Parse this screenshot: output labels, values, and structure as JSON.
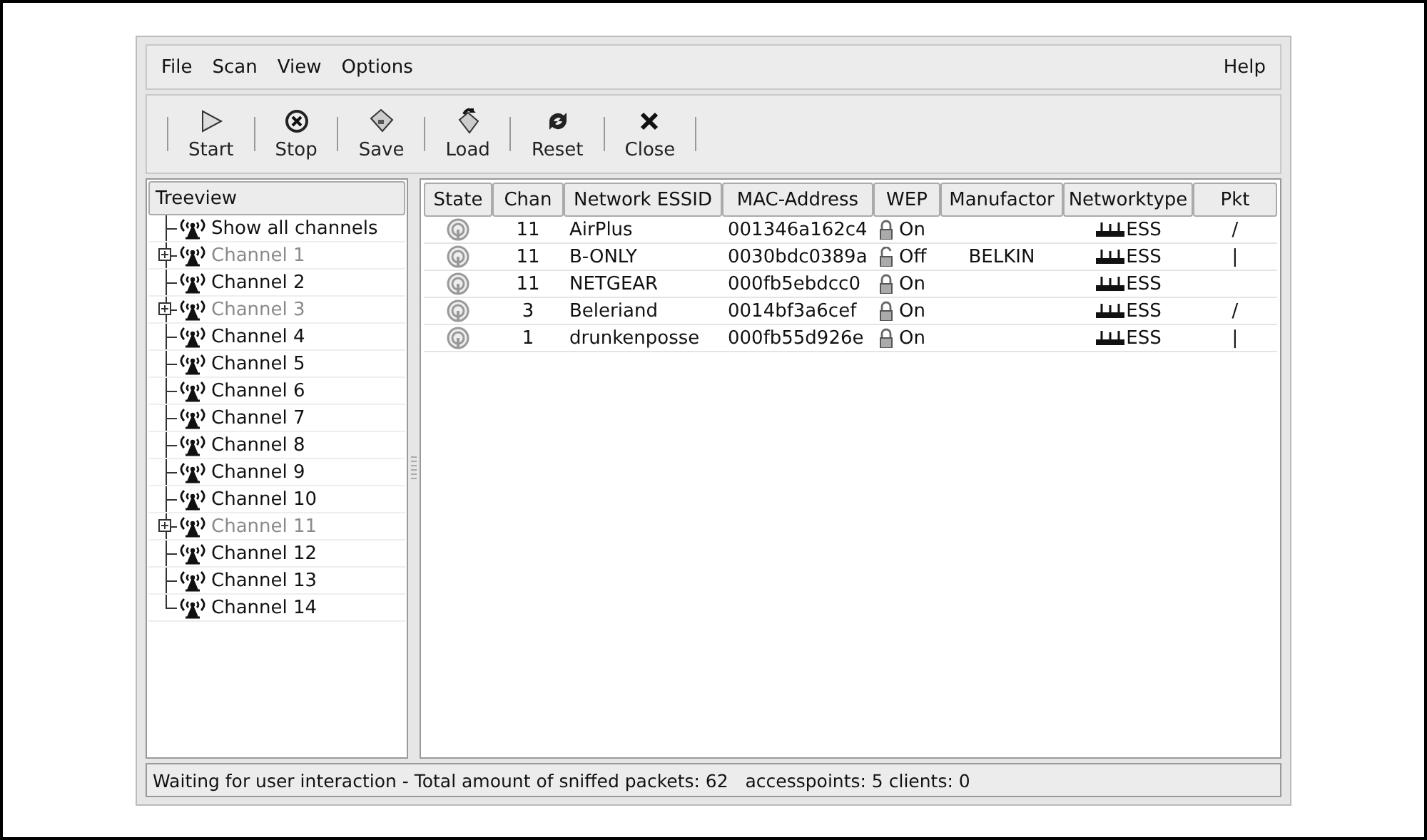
{
  "menu": {
    "items": [
      "File",
      "Scan",
      "View",
      "Options"
    ],
    "help": "Help"
  },
  "toolbar": [
    {
      "kind": "start",
      "label": "Start"
    },
    {
      "kind": "stop",
      "label": "Stop"
    },
    {
      "kind": "save",
      "label": "Save"
    },
    {
      "kind": "load",
      "label": "Load"
    },
    {
      "kind": "reset",
      "label": "Reset"
    },
    {
      "kind": "close",
      "label": "Close"
    }
  ],
  "tree": {
    "header": "Treeview",
    "items": [
      {
        "label": "Show all channels",
        "has_networks": false
      },
      {
        "label": "Channel 1",
        "has_networks": true
      },
      {
        "label": "Channel 2",
        "has_networks": false
      },
      {
        "label": "Channel 3",
        "has_networks": true
      },
      {
        "label": "Channel 4",
        "has_networks": false
      },
      {
        "label": "Channel 5",
        "has_networks": false
      },
      {
        "label": "Channel 6",
        "has_networks": false
      },
      {
        "label": "Channel 7",
        "has_networks": false
      },
      {
        "label": "Channel 8",
        "has_networks": false
      },
      {
        "label": "Channel 9",
        "has_networks": false
      },
      {
        "label": "Channel 10",
        "has_networks": false
      },
      {
        "label": "Channel 11",
        "has_networks": true
      },
      {
        "label": "Channel 12",
        "has_networks": false
      },
      {
        "label": "Channel 13",
        "has_networks": false
      },
      {
        "label": "Channel 14",
        "has_networks": false
      }
    ]
  },
  "table": {
    "columns": [
      "State",
      "Chan",
      "Network ESSID",
      "MAC-Address",
      "WEP",
      "Manufactor",
      "Networktype",
      "Pkt"
    ],
    "rows": [
      {
        "chan": "11",
        "essid": "AirPlus",
        "mac": "001346a162c4",
        "wep_locked": true,
        "wep": "On",
        "network_type": "ESS",
        "pkt": "/"
      },
      {
        "chan": "11",
        "essid": "B-ONLY",
        "mac": "0030bdc0389a",
        "wep_locked": false,
        "wep": "Off",
        "manufactor": "BELKIN",
        "network_type": "ESS",
        "pkt": "|"
      },
      {
        "chan": "11",
        "essid": "NETGEAR",
        "mac": "000fb5ebdcc0",
        "wep_locked": true,
        "wep": "On",
        "network_type": "ESS"
      },
      {
        "chan": "3",
        "essid": "Beleriand",
        "mac": "0014bf3a6cef",
        "wep_locked": true,
        "wep": "On",
        "network_type": "ESS",
        "pkt": "/"
      },
      {
        "chan": "1",
        "essid": "drunkenposse",
        "mac": "000fb55d926e",
        "wep_locked": true,
        "wep": "On",
        "network_type": "ESS",
        "pkt": "|"
      }
    ]
  },
  "status_bar": "Waiting for user interaction - Total amount of sniffed packets: 62   accesspoints: 5 clients: 0"
}
